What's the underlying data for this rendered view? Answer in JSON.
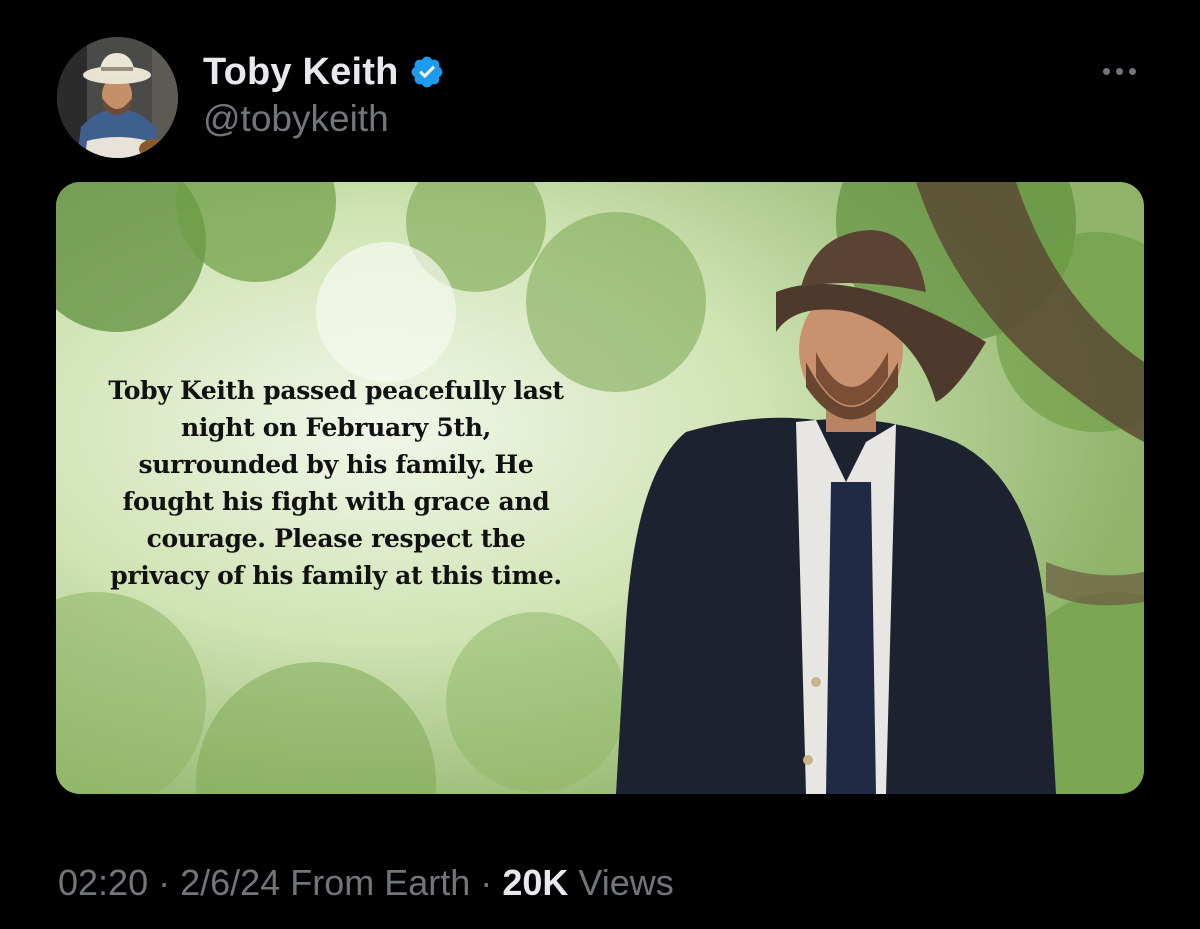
{
  "author": {
    "display_name": "Toby Keith",
    "handle": "@tobykeith",
    "verified": true
  },
  "post": {
    "image_text": "Toby Keith passed peacefully last\nnight on February 5th,\nsurrounded by his family. He\nfought his fight with grace and\ncourage. Please respect the\nprivacy of his family at this time."
  },
  "meta": {
    "time": "02:20",
    "date": "2/6/24",
    "source": "From Earth",
    "separator": "·",
    "views_count": "20K",
    "views_label": "Views"
  },
  "colors": {
    "background": "#000000",
    "primary_text": "#e7e9ea",
    "secondary_text": "#71767b",
    "verified_badge": "#1d9bf0"
  },
  "icons": {
    "verified": "verified-badge-icon",
    "more": "more-options-icon"
  }
}
